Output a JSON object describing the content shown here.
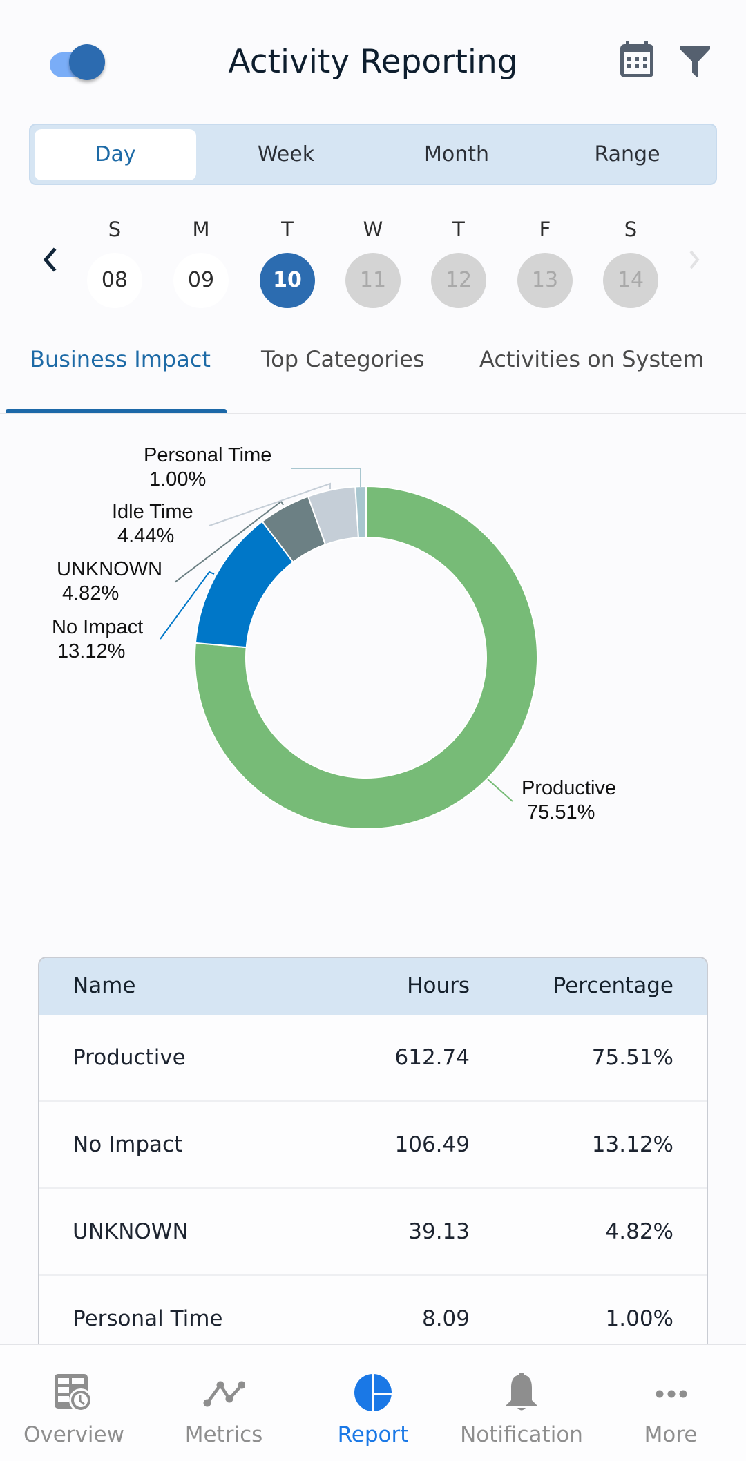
{
  "header": {
    "title": "Activity Reporting",
    "toggle_on": true,
    "icons": [
      "calendar-icon",
      "filter-icon"
    ]
  },
  "period_tabs": [
    {
      "label": "Day",
      "active": true
    },
    {
      "label": "Week",
      "active": false
    },
    {
      "label": "Month",
      "active": false
    },
    {
      "label": "Range",
      "active": false
    }
  ],
  "week": {
    "days": [
      {
        "letter": "S",
        "date": "08",
        "state": "past"
      },
      {
        "letter": "M",
        "date": "09",
        "state": "past"
      },
      {
        "letter": "T",
        "date": "10",
        "state": "selected"
      },
      {
        "letter": "W",
        "date": "11",
        "state": "future"
      },
      {
        "letter": "T",
        "date": "12",
        "state": "future"
      },
      {
        "letter": "F",
        "date": "13",
        "state": "future"
      },
      {
        "letter": "S",
        "date": "14",
        "state": "future"
      }
    ],
    "prev_icon": "chevron-left-icon",
    "next_icon": "chevron-right-icon"
  },
  "report_tabs": [
    {
      "label": "Business Impact",
      "active": true
    },
    {
      "label": "Top Categories",
      "active": false
    },
    {
      "label": "Activities on System",
      "active": false
    }
  ],
  "chart_data": {
    "type": "pie",
    "variant": "donut",
    "title": "",
    "slices": [
      {
        "label": "Productive",
        "value": 75.51,
        "display": "75.51%",
        "color": "#77bb77"
      },
      {
        "label": "No Impact",
        "value": 13.12,
        "display": "13.12%",
        "color": "#0077c8"
      },
      {
        "label": "UNKNOWN",
        "value": 4.82,
        "display": "4.82%",
        "color": "#6c8084"
      },
      {
        "label": "Idle Time",
        "value": 4.44,
        "display": "4.44%",
        "color": "#c5ced7"
      },
      {
        "label": "Personal Time",
        "value": 1.0,
        "display": "1.00%",
        "color": "#a8c6cf"
      }
    ],
    "start_angle": "top",
    "direction": "clockwise",
    "legend": "none",
    "labels": "outside-with-leader-lines"
  },
  "table": {
    "columns": [
      "Name",
      "Hours",
      "Percentage"
    ],
    "rows": [
      {
        "name": "Productive",
        "hours": "612.74",
        "percentage": "75.51%"
      },
      {
        "name": "No Impact",
        "hours": "106.49",
        "percentage": "13.12%"
      },
      {
        "name": "UNKNOWN",
        "hours": "39.13",
        "percentage": "4.82%"
      },
      {
        "name": "Personal Time",
        "hours": "8.09",
        "percentage": "1.00%"
      }
    ]
  },
  "bottom_nav": [
    {
      "label": "Overview",
      "icon": "overview-icon",
      "active": false
    },
    {
      "label": "Metrics",
      "icon": "metrics-icon",
      "active": false
    },
    {
      "label": "Report",
      "icon": "report-icon",
      "active": true
    },
    {
      "label": "Notification",
      "icon": "bell-icon",
      "active": false
    },
    {
      "label": "More",
      "icon": "more-icon",
      "active": false
    }
  ],
  "colors": {
    "accent": "#1d6aa6",
    "selected_day": "#2c6cb0",
    "nav_active": "#1a78e6",
    "segment_bg": "#d6e5f3"
  }
}
